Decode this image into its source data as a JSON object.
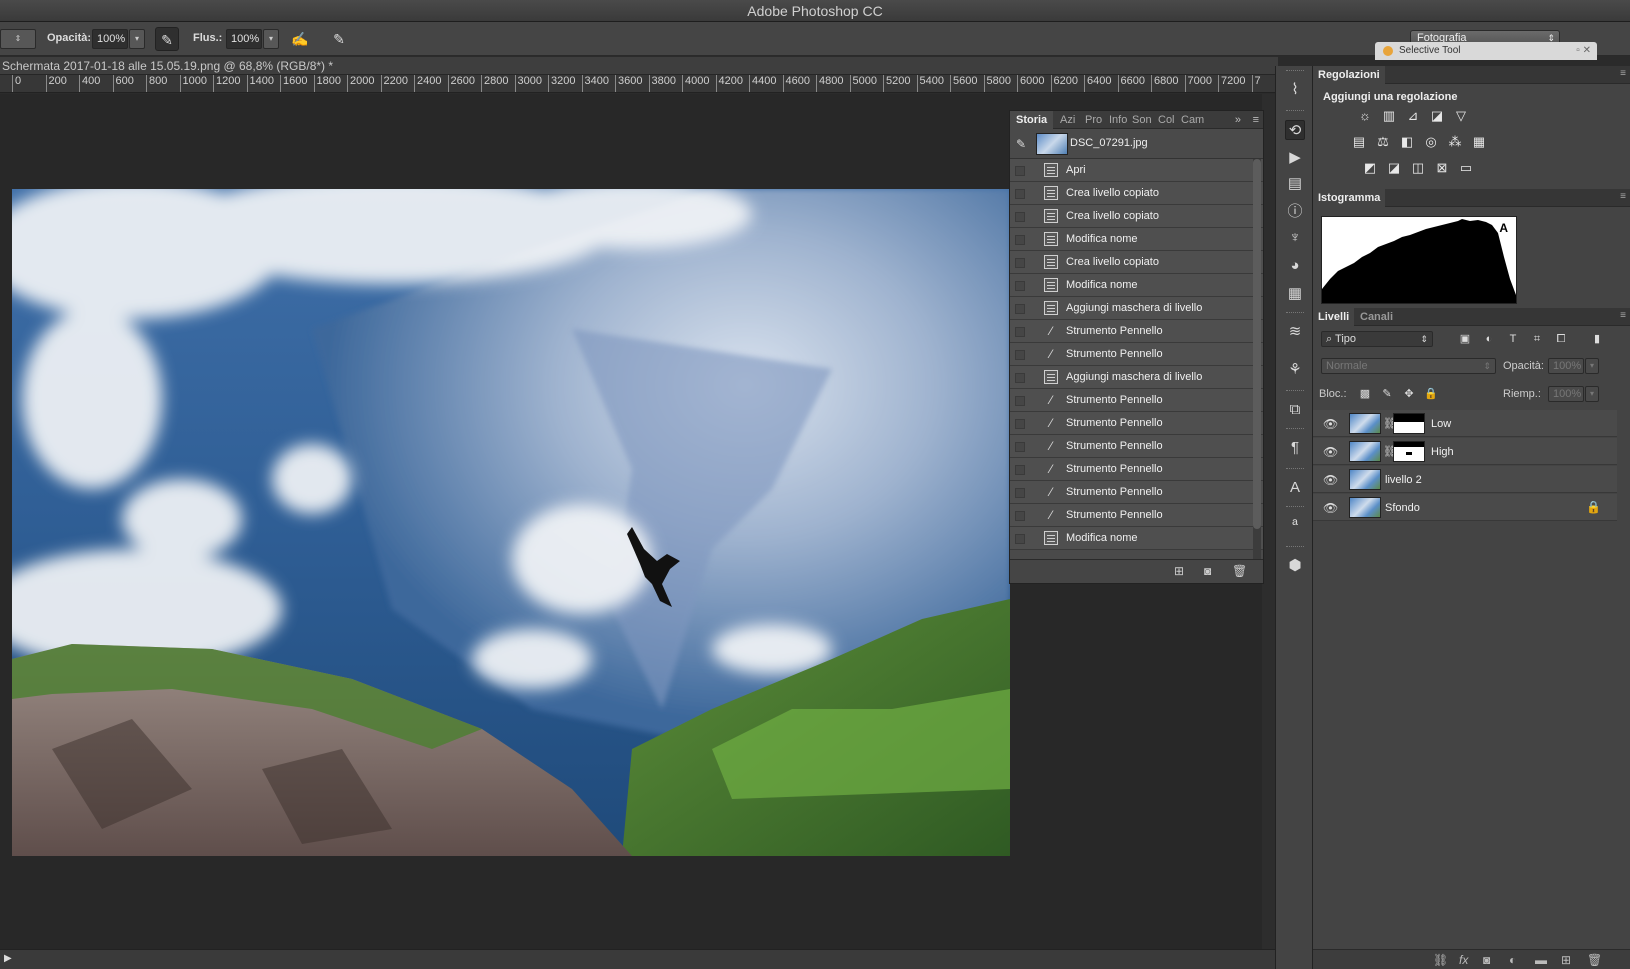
{
  "app": {
    "title": "Adobe Photoshop CC"
  },
  "options_bar": {
    "opacity_label": "Opacità:",
    "opacity_value": "100%",
    "flow_label": "Flus.:",
    "flow_value": "100%",
    "workspace": "Fotografia"
  },
  "floating_tab": {
    "label": "Selective Tool"
  },
  "document": {
    "tab_title": "Schermata 2017-01-18 alle 15.05.19.png @ 68,8% (RGB/8*) *",
    "ruler_ticks": [
      "0",
      "200",
      "400",
      "600",
      "800",
      "1000",
      "1200",
      "1400",
      "1600",
      "1800",
      "2000",
      "2200",
      "2400",
      "2600",
      "2800",
      "3000",
      "3200",
      "3400",
      "3600",
      "3800",
      "4000",
      "4200",
      "4400",
      "4600",
      "4800",
      "5000",
      "5200",
      "5400",
      "5600",
      "5800",
      "6000",
      "6200",
      "6400",
      "6600",
      "6800",
      "7000",
      "7200",
      "7"
    ]
  },
  "history_panel": {
    "tabs": [
      "Storia",
      "Azi",
      "Pro",
      "Info",
      "Son",
      "Col",
      "Cam"
    ],
    "snapshot": "DSC_07291.jpg",
    "items": [
      {
        "label": "Apri",
        "icon": "doc"
      },
      {
        "label": "Crea livello copiato",
        "icon": "doc"
      },
      {
        "label": "Crea livello copiato",
        "icon": "doc"
      },
      {
        "label": "Modifica nome",
        "icon": "doc"
      },
      {
        "label": "Crea livello copiato",
        "icon": "doc"
      },
      {
        "label": "Modifica nome",
        "icon": "doc"
      },
      {
        "label": "Aggiungi maschera di livello",
        "icon": "doc"
      },
      {
        "label": "Strumento Pennello",
        "icon": "brush"
      },
      {
        "label": "Strumento Pennello",
        "icon": "brush"
      },
      {
        "label": "Aggiungi maschera di livello",
        "icon": "doc"
      },
      {
        "label": "Strumento Pennello",
        "icon": "brush"
      },
      {
        "label": "Strumento Pennello",
        "icon": "brush"
      },
      {
        "label": "Strumento Pennello",
        "icon": "brush"
      },
      {
        "label": "Strumento Pennello",
        "icon": "brush"
      },
      {
        "label": "Strumento Pennello",
        "icon": "brush"
      },
      {
        "label": "Strumento Pennello",
        "icon": "brush"
      },
      {
        "label": "Modifica nome",
        "icon": "doc"
      }
    ]
  },
  "adjustments": {
    "tab": "Regolazioni",
    "title": "Aggiungi una regolazione"
  },
  "histogram": {
    "tab": "Istogramma",
    "warning": "A"
  },
  "layers_panel": {
    "tabs": [
      "Livelli",
      "Canali"
    ],
    "filter": "Tipo",
    "blend_mode": "Normale",
    "opacity_label": "Opacità:",
    "opacity_value": "100%",
    "lock_label": "Bloc.:",
    "fill_label": "Riemp.:",
    "fill_value": "100%",
    "layers": [
      {
        "name": "Low",
        "has_mask": true,
        "locked": false
      },
      {
        "name": "High",
        "has_mask": true,
        "locked": false
      },
      {
        "name": "livello 2",
        "has_mask": false,
        "locked": false
      },
      {
        "name": "Sfondo",
        "has_mask": false,
        "locked": true
      }
    ]
  }
}
